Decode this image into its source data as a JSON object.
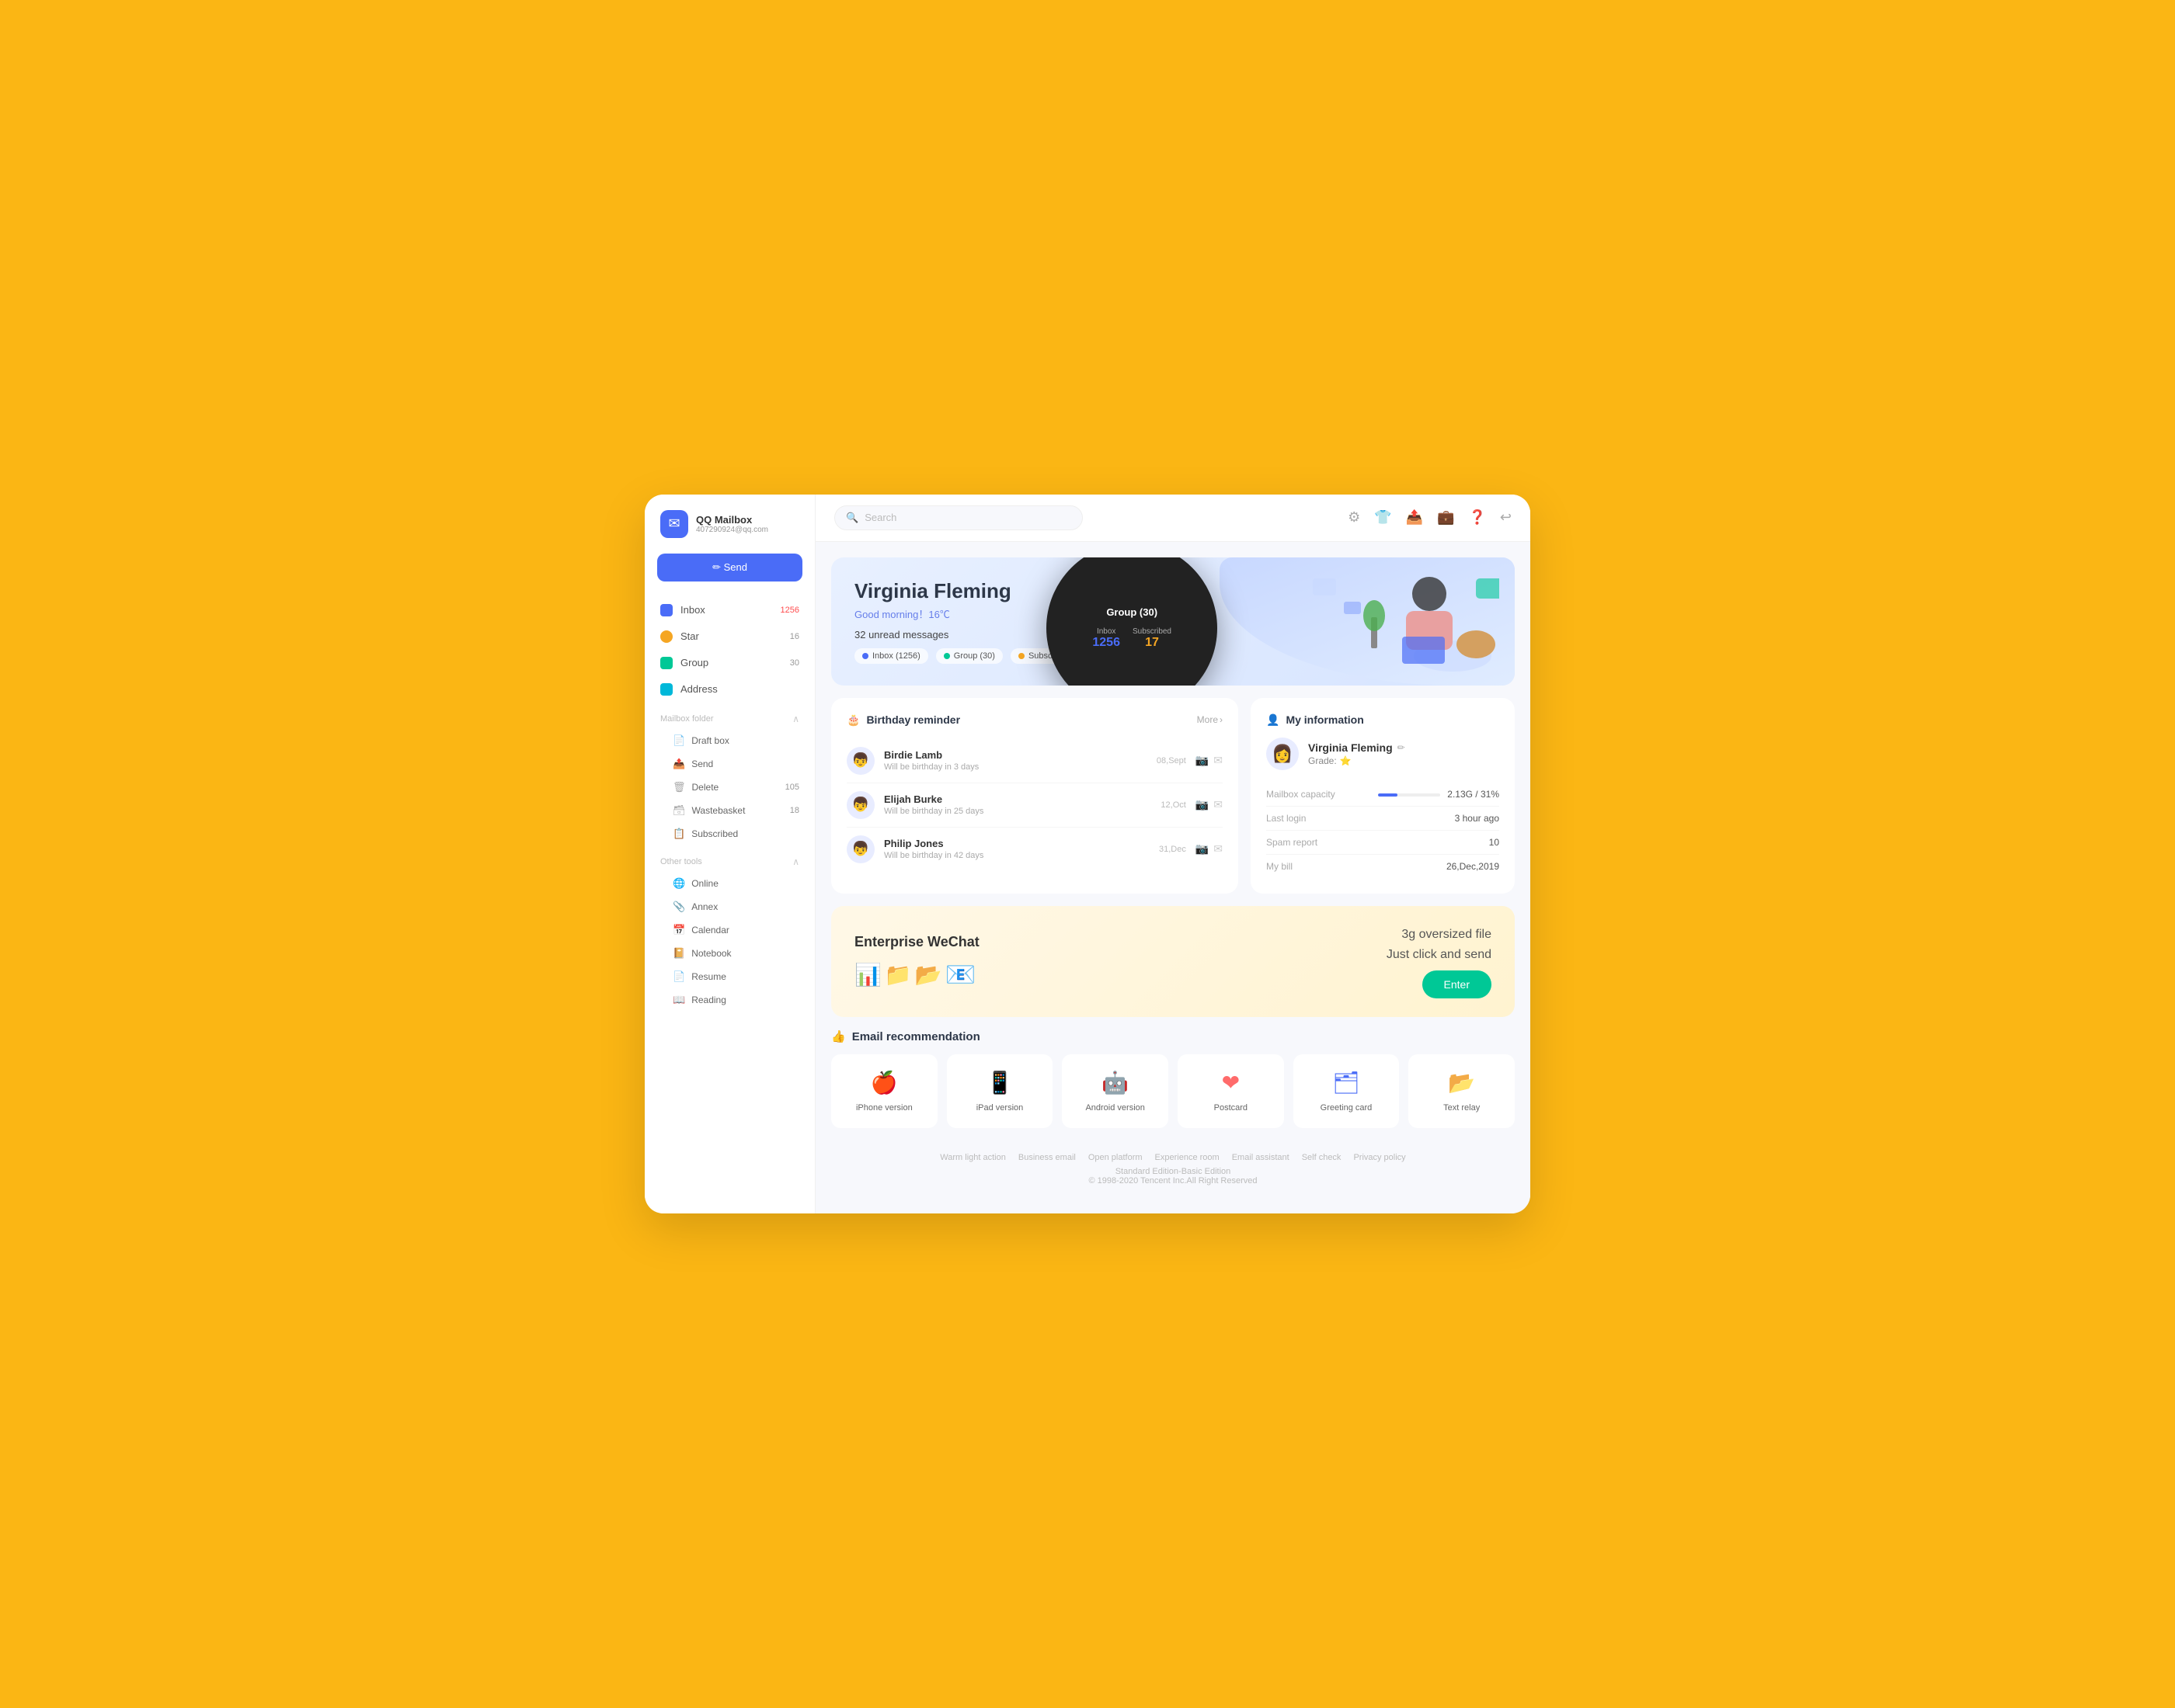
{
  "app": {
    "name": "QQ Mailbox",
    "email": "407290924@qq.com",
    "logo_symbol": "✉"
  },
  "sidebar": {
    "send_label": "✏ Send",
    "nav_items": [
      {
        "id": "inbox",
        "label": "Inbox",
        "badge": "1256",
        "color": "inbox"
      },
      {
        "id": "star",
        "label": "Star",
        "badge": "16",
        "color": "star"
      },
      {
        "id": "group",
        "label": "Group",
        "badge": "30",
        "color": "group"
      },
      {
        "id": "address",
        "label": "Address",
        "badge": "",
        "color": "address"
      }
    ],
    "mailbox_folder": {
      "title": "Mailbox folder",
      "items": [
        {
          "id": "draft",
          "label": "Draft box",
          "badge": "",
          "icon": "📄"
        },
        {
          "id": "send",
          "label": "Send",
          "badge": "",
          "icon": "📤"
        },
        {
          "id": "delete",
          "label": "Delete",
          "badge": "105",
          "icon": "🗑"
        },
        {
          "id": "wastebasket",
          "label": "Wastebasket",
          "badge": "18",
          "icon": "🗃"
        },
        {
          "id": "subscribed",
          "label": "Subscribed",
          "badge": "",
          "icon": "📋"
        }
      ]
    },
    "other_tools": {
      "title": "Other tools",
      "items": [
        {
          "id": "online",
          "label": "Online",
          "badge": "",
          "icon": "🌐"
        },
        {
          "id": "annex",
          "label": "Annex",
          "badge": "",
          "icon": "📎"
        },
        {
          "id": "calendar",
          "label": "Calendar",
          "badge": "",
          "icon": "📅"
        },
        {
          "id": "notebook",
          "label": "Notebook",
          "badge": "",
          "icon": "📔"
        },
        {
          "id": "resume",
          "label": "Resume",
          "badge": "",
          "icon": "📄"
        },
        {
          "id": "reading",
          "label": "Reading",
          "badge": "",
          "icon": "📖"
        }
      ]
    }
  },
  "topbar": {
    "search_placeholder": "Search",
    "icons": [
      "⚙",
      "👕",
      "📤",
      "💼",
      "❓",
      "↩"
    ]
  },
  "hero": {
    "name": "Virginia Fleming",
    "greeting": "Good morning！16℃",
    "unread_label": "32 unread messages",
    "tags": [
      {
        "label": "Inbox (1256)",
        "color": "#4A6CF7"
      },
      {
        "label": "Group (30)",
        "color": "#00C896"
      },
      {
        "label": "Subscribed (17)",
        "color": "#F5A623"
      }
    ]
  },
  "birthday": {
    "title": "Birthday reminder",
    "more_label": "More",
    "items": [
      {
        "name": "Birdie Lamb",
        "days_text": "Will be birthday in 3 days",
        "date": "08,Sept",
        "avatar": "👦"
      },
      {
        "name": "Elijah Burke",
        "days_text": "Will be birthday in 25 days",
        "date": "12,Oct",
        "avatar": "👦"
      },
      {
        "name": "Philip Jones",
        "days_text": "Will be birthday in 42 days",
        "date": "31,Dec",
        "avatar": "👦"
      }
    ]
  },
  "my_info": {
    "title": "My information",
    "user": {
      "name": "Virginia Fleming",
      "grade_label": "Grade:",
      "avatar": "👩"
    },
    "rows": [
      {
        "label": "Mailbox capacity",
        "value": "2.13G / 31%",
        "type": "progress",
        "percent": 31
      },
      {
        "label": "Last login",
        "value": "3 hour ago"
      },
      {
        "label": "Spam report",
        "value": "10"
      },
      {
        "label": "My bill",
        "value": "26,Dec,2019"
      }
    ]
  },
  "wechat": {
    "title": "Enterprise WeChat",
    "text_line1": "3g oversized file",
    "text_line2": "Just click and send",
    "enter_label": "Enter"
  },
  "recommendations": {
    "title": "Email recommendation",
    "items": [
      {
        "id": "iphone",
        "label": "iPhone version",
        "icon": "🍎",
        "color": "#4A6CF7"
      },
      {
        "id": "ipad",
        "label": "iPad version",
        "icon": "📱",
        "color": "#4A6CF7"
      },
      {
        "id": "android",
        "label": "Android version",
        "icon": "🤖",
        "color": "#00C896"
      },
      {
        "id": "postcard",
        "label": "Postcard",
        "icon": "❤",
        "color": "#ff6b6b"
      },
      {
        "id": "greeting",
        "label": "Greeting card",
        "icon": "🗂",
        "color": "#4A6CF7"
      },
      {
        "id": "relay",
        "label": "Text relay",
        "icon": "📂",
        "color": "#F5A623"
      }
    ]
  },
  "footer": {
    "links": [
      "Warm light action",
      "Business email",
      "Open platform",
      "Experience room",
      "Email assistant",
      "Self check",
      "Privacy policy"
    ],
    "copyright": "© 1998-2020 Tencent Inc.All Right Reserved",
    "edition": "Standard Edition-Basic Edition"
  }
}
